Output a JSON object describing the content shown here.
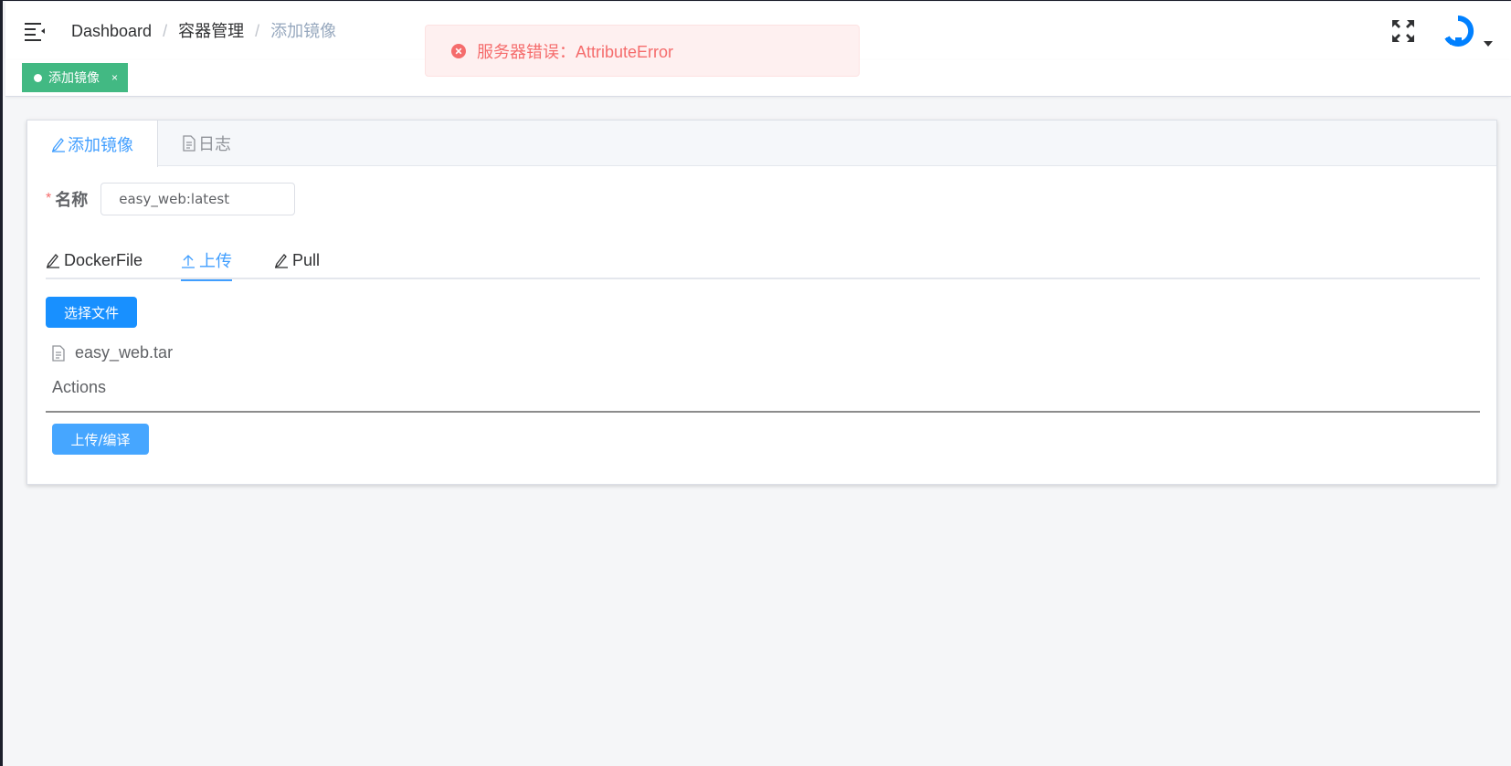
{
  "breadcrumb": {
    "items": [
      "Dashboard",
      "容器管理",
      "添加镜像"
    ],
    "separator": "/"
  },
  "tags": [
    {
      "label": "添加镜像",
      "close": "×",
      "color": "#42b983"
    }
  ],
  "message": {
    "type": "error",
    "text": "服务器错误：AttributeError"
  },
  "card": {
    "tabs": [
      {
        "label": "添加镜像",
        "icon": "edit-icon",
        "active": true
      },
      {
        "label": "日志",
        "icon": "document-icon",
        "active": false
      }
    ]
  },
  "form": {
    "required_mark": "*",
    "name_label": "名称",
    "name_value": "easy_web:latest"
  },
  "sub_tabs": [
    {
      "label": "DockerFile",
      "icon": "edit-icon"
    },
    {
      "label": "上传",
      "icon": "upload-icon",
      "active": true
    },
    {
      "label": "Pull",
      "icon": "edit-icon"
    }
  ],
  "upload": {
    "select_button": "选择文件",
    "file_name": "easy_web.tar",
    "actions_label": "Actions",
    "submit_button": "上传/编译"
  },
  "colors": {
    "primary": "#409eff",
    "tag_green": "#42b983",
    "error": "#f56c6c"
  }
}
